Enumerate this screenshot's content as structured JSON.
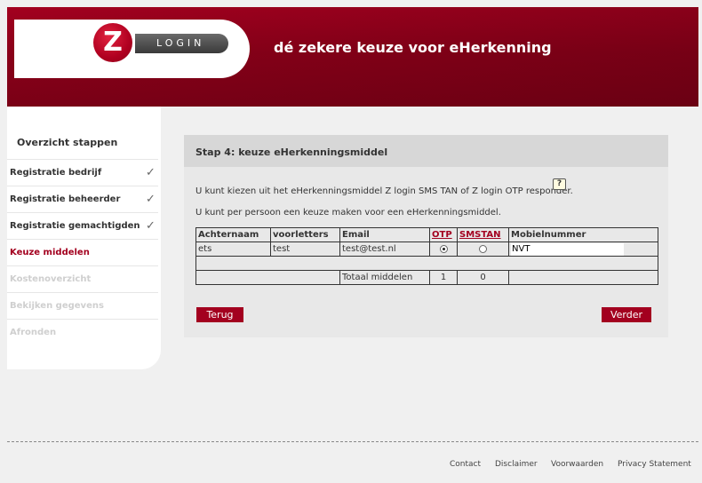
{
  "header": {
    "logo_letter": "Z",
    "logo_text": "LOGIN",
    "tagline": "dé zekere keuze voor eHerkenning"
  },
  "sidebar": {
    "title": "Overzicht stappen",
    "items": [
      {
        "label": "Registratie bedrijf",
        "check": "✓"
      },
      {
        "label": "Registratie beheerder",
        "check": "✓"
      },
      {
        "label": "Registratie gemachtigden",
        "check": "✓"
      },
      {
        "label": "Keuze middelen"
      },
      {
        "label": "Kostenoverzicht"
      },
      {
        "label": "Bekijken gegevens"
      },
      {
        "label": "Afronden"
      }
    ]
  },
  "panel": {
    "title": "Stap 4: keuze eHerkenningsmiddel",
    "intro1": "U kunt kiezen uit het eHerkenningsmiddel Z login SMS TAN of Z login OTP responder.",
    "help_icon": "?",
    "intro2": "U kunt per persoon een keuze maken voor een eHerkenningsmiddel."
  },
  "table": {
    "headers": [
      "Achternaam",
      "voorletters",
      "Email",
      "OTP",
      "SMSTAN",
      "Mobielnummer"
    ],
    "row": {
      "achternaam": "ets",
      "voorletters": "test",
      "email": "test@test.nl",
      "otp_selected": true,
      "mobiel": "NVT"
    },
    "total_label": "Totaal middelen",
    "total_otp": "1",
    "total_smstan": "0"
  },
  "buttons": {
    "back": "Terug",
    "next": "Verder"
  },
  "footer": {
    "links": [
      "Contact",
      "Disclaimer",
      "Voorwaarden",
      "Privacy Statement"
    ]
  },
  "colors": {
    "brand": "#a3001f"
  }
}
